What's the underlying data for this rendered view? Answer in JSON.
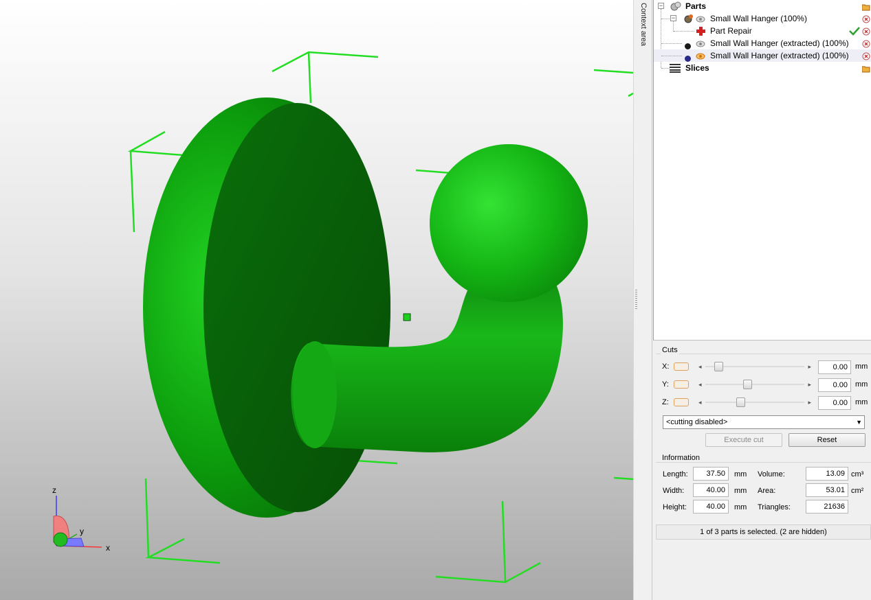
{
  "context_area": {
    "label": "Context area"
  },
  "tree": {
    "parts_label": "Parts",
    "items": [
      {
        "label": "Small Wall Hanger (100%)"
      },
      {
        "label": "Part Repair"
      },
      {
        "label": "Small Wall Hanger (extracted) (100%)"
      },
      {
        "label": "Small Wall Hanger (extracted) (100%)"
      }
    ],
    "slices_label": "Slices"
  },
  "cuts": {
    "title": "Cuts",
    "axes": [
      {
        "label": "X:",
        "value": "0.00",
        "unit": "mm",
        "slider_pos": 0.1
      },
      {
        "label": "Y:",
        "value": "0.00",
        "unit": "mm",
        "slider_pos": 0.42
      },
      {
        "label": "Z:",
        "value": "0.00",
        "unit": "mm",
        "slider_pos": 0.34
      }
    ],
    "mode": "<cutting disabled>",
    "execute_label": "Execute cut",
    "reset_label": "Reset"
  },
  "info": {
    "title": "Information",
    "length_label": "Length:",
    "length": "37.50",
    "length_unit": "mm",
    "width_label": "Width:",
    "width": "40.00",
    "width_unit": "mm",
    "height_label": "Height:",
    "height": "40.00",
    "height_unit": "mm",
    "volume_label": "Volume:",
    "volume": "13.09",
    "volume_unit": "cm³",
    "area_label": "Area:",
    "area": "53.01",
    "area_unit": "cm²",
    "triangles_label": "Triangles:",
    "triangles": "21636"
  },
  "status": "1 of 3 parts is selected. (2 are hidden)",
  "axes_gizmo": {
    "x": "x",
    "y": "y",
    "z": "z"
  },
  "colors": {
    "model_green": "#0a9e0a",
    "bbox_green": "#22dd22",
    "selection_bg": "#eeeef6"
  }
}
